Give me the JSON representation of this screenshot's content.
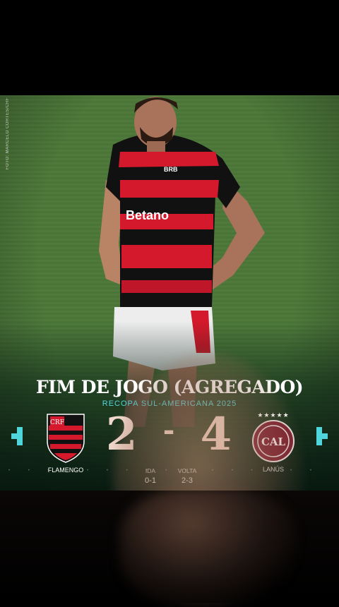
{
  "photo_credit": "FOTO: MARCELO CORTES/CRF",
  "headline": "FIM DE JOGO (AGREGADO)",
  "subtitle": "RECOPA SUL-AMERICANA 2025",
  "score": {
    "home": "2",
    "separator": "-",
    "away": "4"
  },
  "home_team": {
    "name": "FLAMENGO",
    "logo_letters": "CRF"
  },
  "away_team": {
    "name": "LANÚS",
    "logo_letters": "CAL",
    "stars": "★★★★★"
  },
  "legs": {
    "first": {
      "label": "IDA",
      "result": "0-1"
    },
    "second": {
      "label": "VOLTA",
      "result": "2-3"
    }
  },
  "shirt_sponsor": "Betano",
  "shirt_brand": "BRB",
  "colors": {
    "accent": "#4fd6dc",
    "flamengo_red": "#d3192b",
    "flamengo_black": "#111111",
    "lanus_maroon": "#7a1f2e",
    "pitch": "#4d7a3a"
  }
}
